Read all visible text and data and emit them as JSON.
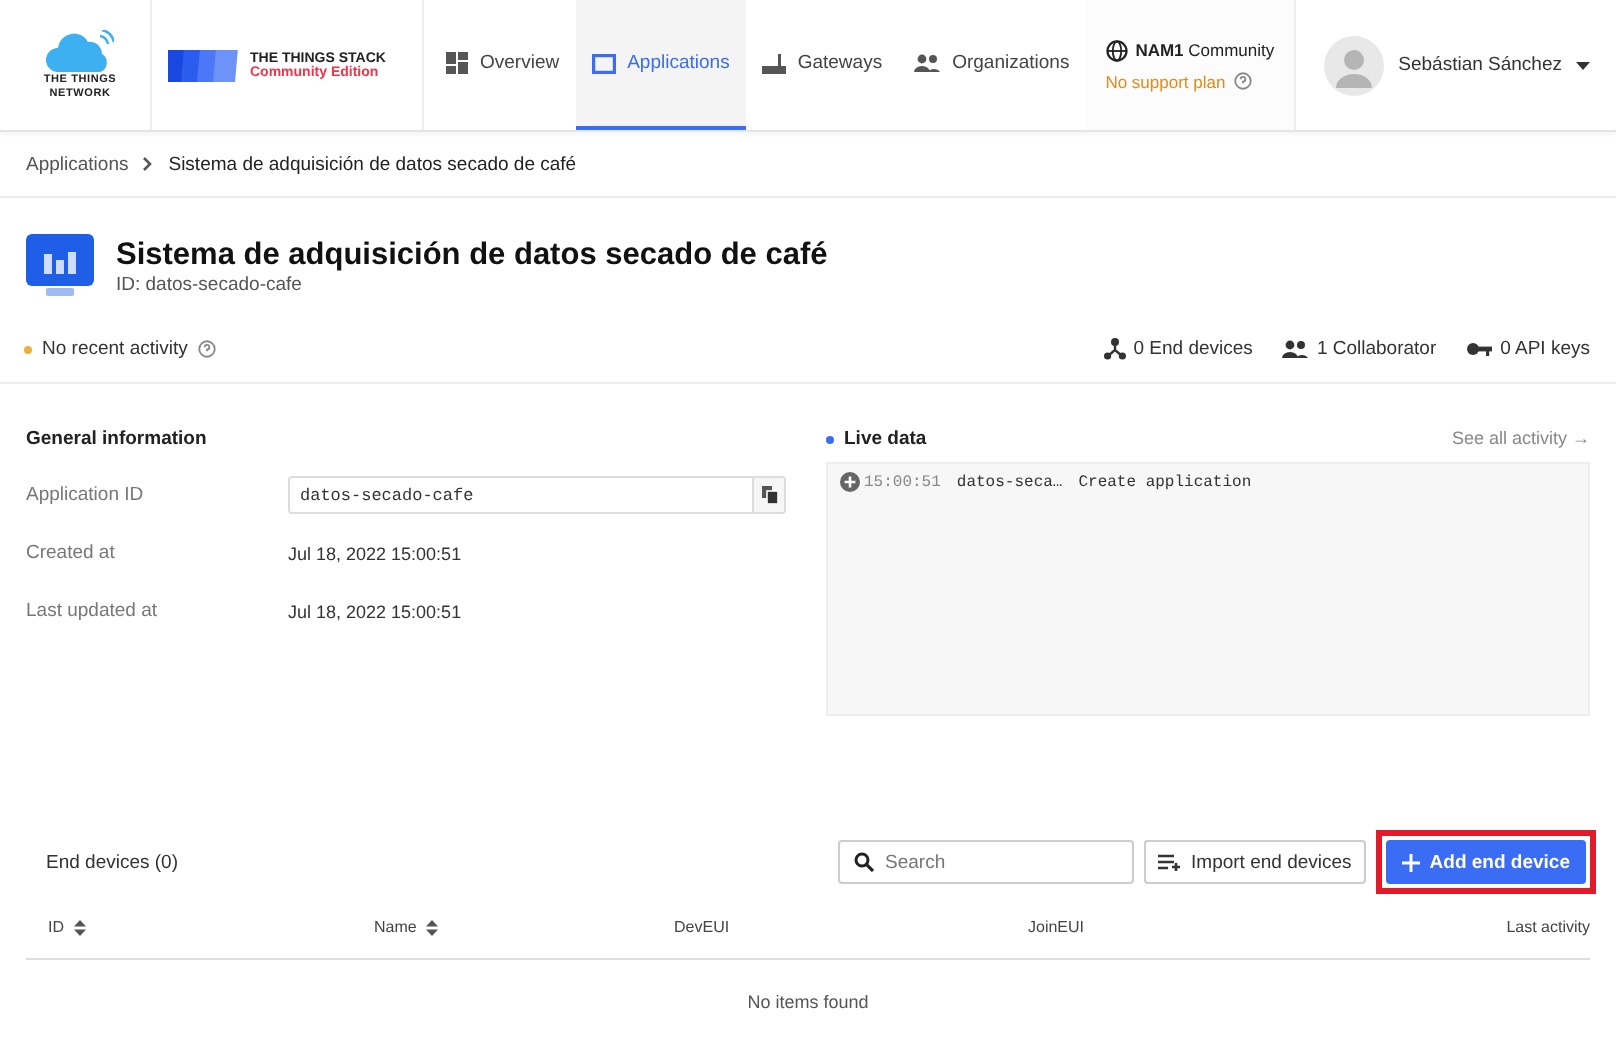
{
  "header": {
    "ttn_logo": [
      "THE THINGS",
      "NETWORK"
    ],
    "stack_logo": {
      "title": "THE THINGS STACK",
      "edition": "Community Edition"
    },
    "nav": [
      {
        "label": "Overview",
        "kind": "grid",
        "selected": false
      },
      {
        "label": "Applications",
        "kind": "window",
        "selected": true
      },
      {
        "label": "Gateways",
        "kind": "router",
        "selected": false
      },
      {
        "label": "Organizations",
        "kind": "people",
        "selected": false
      }
    ],
    "network": {
      "cluster": "NAM1",
      "tier": "Community",
      "plan": "No support plan"
    },
    "user": {
      "name": "Sebástian Sánchez"
    }
  },
  "breadcrumb": [
    "Applications",
    "Sistema de adquisición de datos secado de café"
  ],
  "application": {
    "title": "Sistema de adquisición de datos secado de café",
    "id": "ID: datos-secado-cafe"
  },
  "activity": "No recent activity",
  "stats": [
    {
      "kind": "devices",
      "text": "0 End devices"
    },
    {
      "kind": "people",
      "text": "1 Collaborator"
    },
    {
      "kind": "key",
      "text": "0 API keys"
    }
  ],
  "general": {
    "title": "General information",
    "rows": [
      {
        "kind": "field",
        "label": "Application ID",
        "value": "datos-secado-cafe"
      },
      {
        "kind": "text",
        "label": "Created at",
        "value": "Jul 18, 2022 15:00:51"
      },
      {
        "kind": "text",
        "label": "Last updated at",
        "value": "Jul 18, 2022 15:00:51"
      }
    ]
  },
  "live": {
    "title": "Live data",
    "link": "See all activity →",
    "events": [
      {
        "time": "15:00:51",
        "entity": "datos-seca…",
        "message": "Create application"
      }
    ]
  },
  "end_devices": {
    "title": "End devices (0)",
    "search": {
      "placeholder": "Search"
    },
    "import": "Import end devices",
    "add": {
      "label": "Add end device",
      "highlighted": true
    },
    "columns": [
      {
        "label": "ID",
        "sortable": true
      },
      {
        "label": "Name",
        "sortable": true
      },
      {
        "label": "DevEUI",
        "sortable": false
      },
      {
        "label": "JoinEUI",
        "sortable": false
      },
      {
        "label": "Last activity",
        "sortable": false
      }
    ],
    "empty": "No items found"
  }
}
